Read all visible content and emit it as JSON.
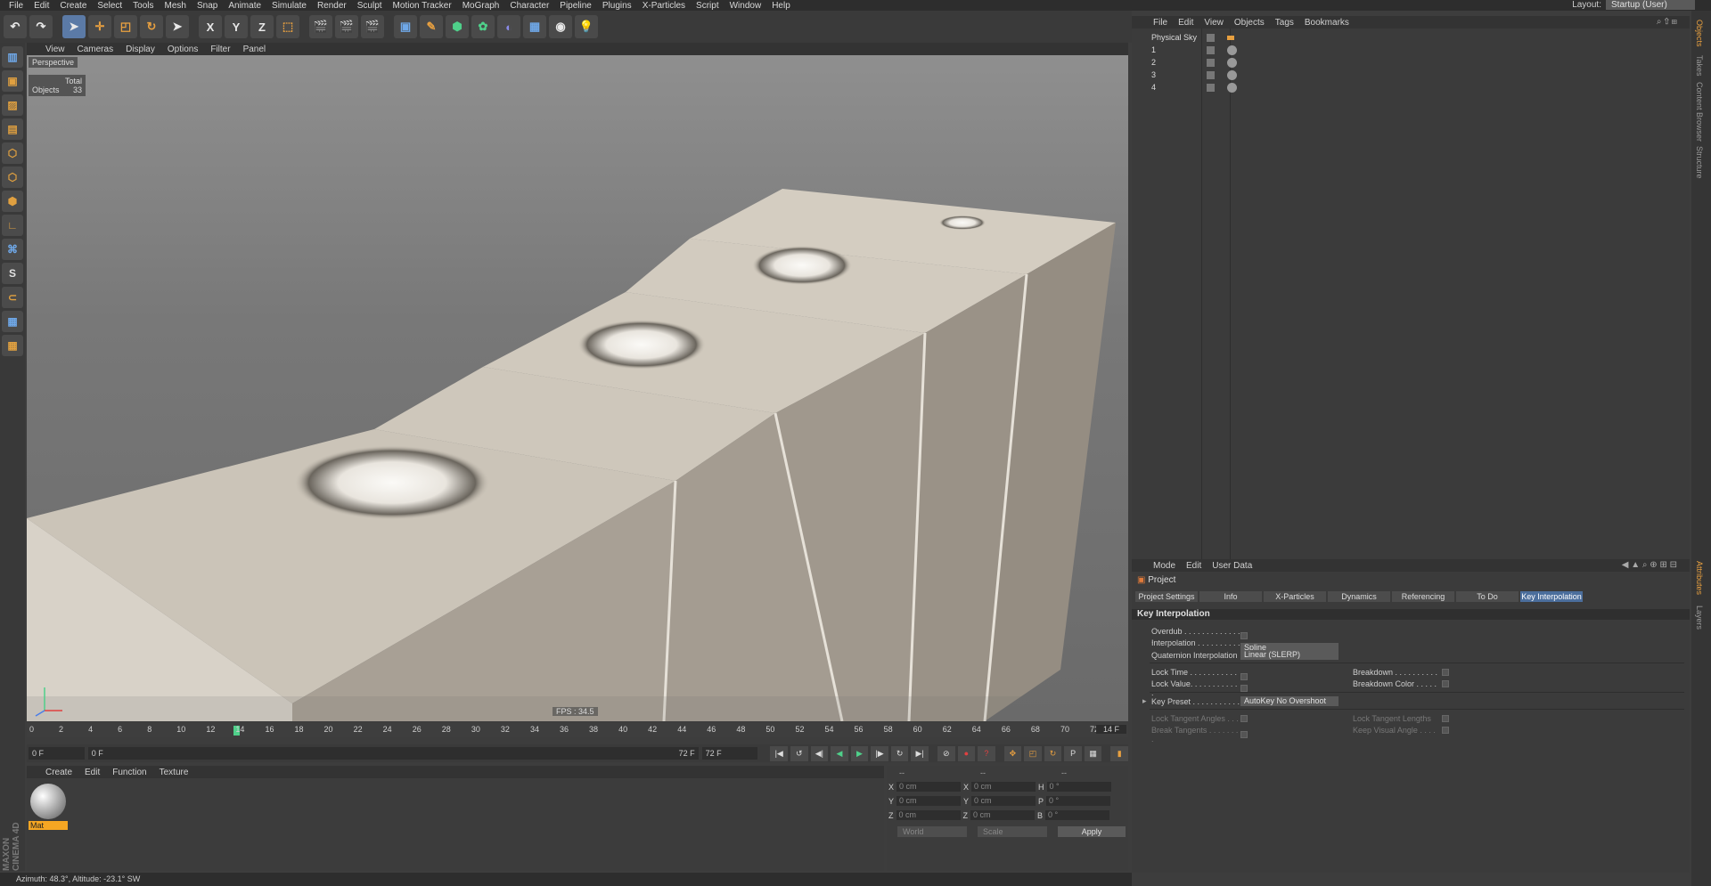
{
  "menubar": {
    "items": [
      "File",
      "Edit",
      "Create",
      "Select",
      "Tools",
      "Mesh",
      "Snap",
      "Animate",
      "Simulate",
      "Render",
      "Sculpt",
      "Motion Tracker",
      "MoGraph",
      "Character",
      "Pipeline",
      "Plugins",
      "X-Particles",
      "Script",
      "Window",
      "Help"
    ],
    "layout_label": "Layout:",
    "layout_value": "Startup (User)"
  },
  "toolbar": {
    "axis_x": "X",
    "axis_y": "Y",
    "axis_z": "Z"
  },
  "left_tools": {
    "snap_label": "S"
  },
  "viewport": {
    "menu": [
      "View",
      "Cameras",
      "Display",
      "Options",
      "Filter",
      "Panel"
    ],
    "label": "Perspective",
    "stats_header": "Total",
    "stats_name": "Objects",
    "stats_value": "33",
    "fps": "FPS : 34.5"
  },
  "timeline": {
    "ticks": [
      "0",
      "2",
      "4",
      "6",
      "8",
      "10",
      "12",
      "14",
      "16",
      "18",
      "20",
      "22",
      "24",
      "26",
      "28",
      "30",
      "32",
      "34",
      "36",
      "38",
      "40",
      "42",
      "44",
      "46",
      "48",
      "50",
      "52",
      "54",
      "56",
      "58",
      "60",
      "62",
      "64",
      "66",
      "68",
      "70",
      "72"
    ],
    "current_frame_label": "14 F",
    "start": "0 F",
    "range_start": "0 F",
    "range_end": "72 F",
    "end": "72 F"
  },
  "material_manager": {
    "menu": [
      "Create",
      "Edit",
      "Function",
      "Texture"
    ],
    "material_name": "Mat",
    "brand_top": "MAXON",
    "brand_bottom": "CINEMA 4D"
  },
  "coordinates": {
    "header": [
      "--",
      "--",
      "--"
    ],
    "rows": [
      {
        "a": "X",
        "av": "0 cm",
        "b": "X",
        "bv": "0 cm",
        "c": "H",
        "cv": "0 °"
      },
      {
        "a": "Y",
        "av": "0 cm",
        "b": "Y",
        "bv": "0 cm",
        "c": "P",
        "cv": "0 °"
      },
      {
        "a": "Z",
        "av": "0 cm",
        "b": "Z",
        "bv": "0 cm",
        "c": "B",
        "cv": "0 °"
      }
    ],
    "space": "World",
    "mode": "Scale",
    "apply": "Apply"
  },
  "statusbar": {
    "text": "Azimuth: 48.3°, Altitude: -23.1°  SW"
  },
  "object_manager": {
    "menu": [
      "File",
      "Edit",
      "View",
      "Objects",
      "Tags",
      "Bookmarks"
    ],
    "objects": [
      "Physical Sky",
      "1",
      "2",
      "3",
      "4"
    ]
  },
  "right_tabs": [
    "Objects",
    "Takes",
    "Content Browser",
    "Structure",
    "Attributes",
    "Layers"
  ],
  "attributes": {
    "menu": [
      "Mode",
      "Edit",
      "User Data"
    ],
    "title": "Project",
    "tabs": [
      "Project Settings",
      "Info",
      "X-Particles",
      "Dynamics",
      "Referencing",
      "To Do",
      "Key Interpolation"
    ],
    "section": "Key Interpolation",
    "overdub": "Overdub . . . . . . . . . . . . . .",
    "interpolation": "Interpolation . . . . . . . . . . .",
    "interpolation_value": "Spline",
    "quaternion": "Quaternion Interpolation",
    "quaternion_value": "Linear (SLERP)",
    "lock_time": "Lock Time . . . . . . . . . . . .",
    "lock_value": "Lock Value. . . . . . . . . . . .",
    "breakdown": "Breakdown . . . . . . . . . .",
    "breakdown_color": "Breakdown Color . . . . .",
    "key_preset": "Key Preset . . . . . . . . . . .",
    "key_preset_value": "AutoKey No Overshoot",
    "lock_tangent_angles": "Lock Tangent Angles . . .",
    "break_tangents": "Break Tangents . . . . . . . .",
    "lock_tangent_lengths": "Lock Tangent Lengths",
    "keep_visual_angle": "Keep Visual Angle . . . ."
  }
}
